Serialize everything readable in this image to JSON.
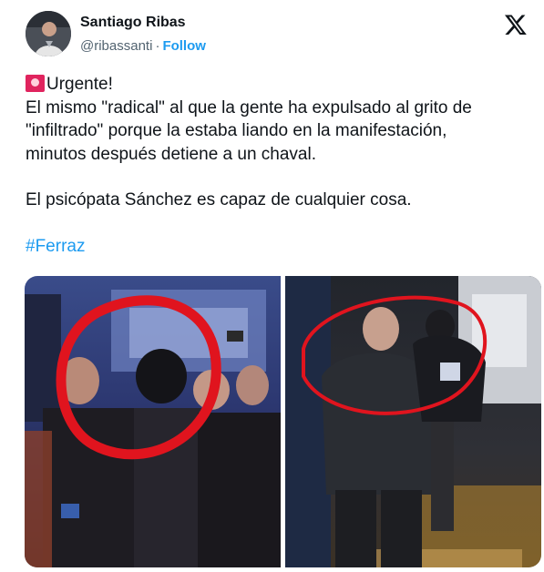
{
  "author": {
    "name": "Santiago Ribas",
    "handle": "@ribassanti",
    "separator": "·",
    "follow_label": "Follow"
  },
  "tweet": {
    "line1": "Urgente!",
    "line2": "El mismo \"radical\" al que la gente ha expulsado al grito de",
    "line3": "\"infiltrado\" porque la estaba liando en la manifestación,",
    "line4": "minutos después detiene a un chaval.",
    "line5": "El psicópata Sánchez es capaz de cualquier cosa.",
    "hashtag": "#Ferraz"
  },
  "icons": {
    "brand": "x-logo-icon",
    "siren": "rotating-light-emoji"
  },
  "colors": {
    "link": "#1d9bf0",
    "text": "#0f1419",
    "muted": "#536471",
    "circle": "#e0141e"
  }
}
